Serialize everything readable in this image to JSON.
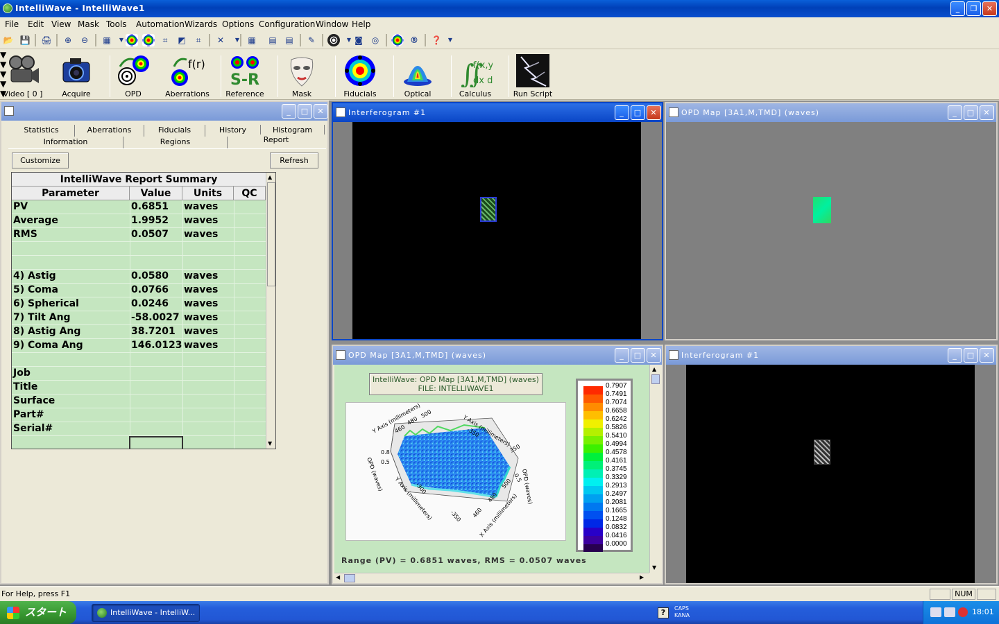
{
  "app": {
    "title": "IntelliWave - IntelliWave1"
  },
  "menu": [
    "File",
    "Edit",
    "View",
    "Mask",
    "Tools",
    "Automation",
    "Wizards",
    "Options",
    "Configuration",
    "Window",
    "Help"
  ],
  "big_toolbar": [
    {
      "label": "Video [ 0 ]",
      "icon": "video-camera-icon"
    },
    {
      "label": "Acquire",
      "icon": "camera-icon"
    },
    {
      "label": "OPD",
      "icon": "opd-icon"
    },
    {
      "label": "Aberrations",
      "icon": "aberrations-icon"
    },
    {
      "label": "Reference",
      "icon": "sr-reference-icon"
    },
    {
      "label": "Mask",
      "icon": "mask-icon"
    },
    {
      "label": "Fiducials",
      "icon": "fiducials-icon"
    },
    {
      "label": "Optical",
      "icon": "optical-icon"
    },
    {
      "label": "Calculus",
      "icon": "calculus-icon"
    },
    {
      "label": "Run Script",
      "icon": "lightning-icon"
    }
  ],
  "report": {
    "tabs_row1": [
      "Statistics",
      "Aberrations",
      "Fiducials",
      "History",
      "Histogram"
    ],
    "tabs_row2": [
      "Information",
      "Regions",
      "Report"
    ],
    "customize_label": "Customize",
    "refresh_label": "Refresh",
    "table_title": "IntelliWave Report Summary",
    "columns": [
      "Parameter",
      "Value",
      "Units",
      "QC"
    ],
    "rows": [
      {
        "param": "PV",
        "value": "0.6851",
        "units": "waves"
      },
      {
        "param": "Average",
        "value": "1.9952",
        "units": "waves"
      },
      {
        "param": "RMS",
        "value": "0.0507",
        "units": "waves"
      },
      {
        "param": "",
        "value": "",
        "units": ""
      },
      {
        "param": "",
        "value": "",
        "units": ""
      },
      {
        "param": " 4) Astig",
        "value": "0.0580",
        "units": "waves"
      },
      {
        "param": " 5) Coma",
        "value": "0.0766",
        "units": "waves"
      },
      {
        "param": " 6) Spherical",
        "value": "0.0246",
        "units": "waves"
      },
      {
        "param": " 7) Tilt Ang",
        "value": "-58.0027",
        "units": "waves"
      },
      {
        "param": " 8) Astig Ang",
        "value": "38.7201",
        "units": "waves"
      },
      {
        "param": " 9) Coma Ang",
        "value": "146.0123",
        "units": "waves"
      },
      {
        "param": "",
        "value": "",
        "units": ""
      },
      {
        "param": "Job",
        "value": "",
        "units": ""
      },
      {
        "param": "Title",
        "value": "",
        "units": ""
      },
      {
        "param": "Surface",
        "value": "",
        "units": ""
      },
      {
        "param": "Part#",
        "value": "",
        "units": ""
      },
      {
        "param": "Serial#",
        "value": "",
        "units": ""
      }
    ]
  },
  "windows": {
    "interferogram_top": "Interferogram #1",
    "opd_top": "OPD Map [3A1,M,TMD]  (waves)",
    "opd_bottom": "OPD Map [3A1,M,TMD]  (waves)",
    "interferogram_bottom": "Interferogram #1"
  },
  "opd_plot": {
    "header_line1": "IntelliWave: OPD Map [3A1,M,TMD]  (waves)",
    "header_line2": "FILE: INTELLIWAVE1",
    "range_text": "Range (PV) =   0.6851 waves, RMS =   0.0507 waves",
    "axis_labels": {
      "y_top": "Y Axis (millimeters)",
      "x_top": "Y Axis (millimeters)",
      "z": "OPD (waves)",
      "y_bottom": "Y Axis (millimeters)",
      "x_bottom": "X Axis (millimeters)",
      "z_right": "OPD (waves)"
    },
    "tick_labels": {
      "top_left": [
        "460",
        "480",
        "500"
      ],
      "top_right": [
        "-350"
      ],
      "left_z": [
        "0.5",
        "0.8"
      ],
      "right_top": [
        "350"
      ],
      "right_z": [
        "0.5"
      ],
      "bottom_left": [
        "-300",
        "-350"
      ],
      "bottom_right": [
        "460",
        "480",
        "500"
      ]
    },
    "colorbar_labels": [
      "0.7907",
      "0.7491",
      "0.7074",
      "0.6658",
      "0.6242",
      "0.5826",
      "0.5410",
      "0.4994",
      "0.4578",
      "0.4161",
      "0.3745",
      "0.3329",
      "0.2913",
      "0.2497",
      "0.2081",
      "0.1665",
      "0.1248",
      "0.0832",
      "0.0416",
      "0.0000"
    ],
    "colorbar_colors": [
      "#ff2a00",
      "#ff5a00",
      "#ff8c00",
      "#ffbe00",
      "#f0f000",
      "#b4f000",
      "#78f000",
      "#3cf000",
      "#00f03c",
      "#00f078",
      "#00f0b4",
      "#00f0f0",
      "#00c8f0",
      "#00a0f0",
      "#0078f0",
      "#0050f0",
      "#0028e6",
      "#2800c8",
      "#3c00a0",
      "#280050"
    ]
  },
  "status": {
    "help_text": "For Help, press F1",
    "num": "NUM"
  },
  "taskbar": {
    "start_label": "スタート",
    "task_label": "IntelliWave - IntelliW...",
    "caps": "CAPS",
    "kana": "KANA",
    "clock": "18:01"
  }
}
